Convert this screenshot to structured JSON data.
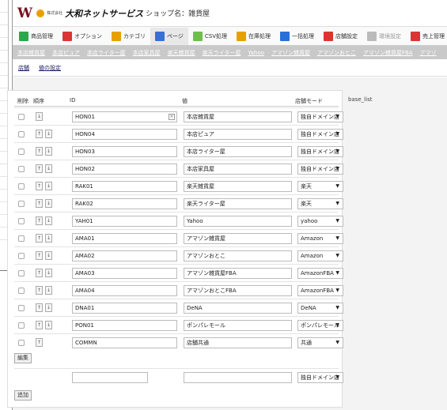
{
  "header": {
    "logo": "W",
    "company_small": "株式会社",
    "company_name": "大和ネットサービス",
    "shop_label": "ショップ名：雑貨屋"
  },
  "menu": [
    {
      "label": "商品管理",
      "icon": "product-icon",
      "color": "#2aa84a"
    },
    {
      "label": "オプション",
      "icon": "option-icon",
      "color": "#d33"
    },
    {
      "label": "カテゴリ",
      "icon": "category-icon",
      "color": "#e8a000"
    },
    {
      "label": "ページ",
      "icon": "page-icon",
      "color": "#3a6fd8"
    },
    {
      "label": "CSV処理",
      "icon": "csv-icon",
      "color": "#6cc04a"
    },
    {
      "label": "在庫処理",
      "icon": "stock-icon",
      "color": "#e8a000"
    },
    {
      "label": "一括処理",
      "icon": "batch-icon",
      "color": "#2a6fd8"
    },
    {
      "label": "店舗設定",
      "icon": "store-settings-icon",
      "color": "#d33"
    },
    {
      "label": "環境設定",
      "icon": "env-settings-icon",
      "color": "#bbb"
    },
    {
      "label": "売上管理",
      "icon": "sales-icon",
      "color": "#d33"
    }
  ],
  "subnav": [
    "本店雑貨屋",
    "本店ピュア",
    "本店ライター屋",
    "本店家具屋",
    "楽天雑貨屋",
    "楽天ライター屋",
    "Yahoo",
    "アマゾン雑貨屋",
    "アマゾンおとこ",
    "アマゾン雑貨屋FBA",
    "アマゾ"
  ],
  "tabs": [
    "店舗",
    "値の設定"
  ],
  "side_note": "base_list",
  "table": {
    "headers": {
      "del": "削除",
      "order": "順序",
      "id": "ID",
      "value": "値",
      "mode": "店舗モード"
    },
    "rows": [
      {
        "id": "HON01",
        "value": "本店雑貨屋",
        "mode": "独自ドメイン店"
      },
      {
        "id": "HON04",
        "value": "本店ピュア",
        "mode": "独自ドメイン店"
      },
      {
        "id": "HON03",
        "value": "本店ライター屋",
        "mode": "独自ドメイン店"
      },
      {
        "id": "HON02",
        "value": "本店家具屋",
        "mode": "独自ドメイン店"
      },
      {
        "id": "RAK01",
        "value": "楽天雑貨屋",
        "mode": "楽天"
      },
      {
        "id": "RAK02",
        "value": "楽天ライター屋",
        "mode": "楽天"
      },
      {
        "id": "YAH01",
        "value": "Yahoo",
        "mode": "yahoo"
      },
      {
        "id": "AMA01",
        "value": "アマゾン雑貨屋",
        "mode": "Amazon"
      },
      {
        "id": "AMA02",
        "value": "アマゾンおとこ",
        "mode": "Amazon"
      },
      {
        "id": "AMA03",
        "value": "アマゾン雑貨屋FBA",
        "mode": "AmazonFBA"
      },
      {
        "id": "AMA04",
        "value": "アマゾンおとこFBA",
        "mode": "AmazonFBA"
      },
      {
        "id": "DNA01",
        "value": "DeNA",
        "mode": "DeNA"
      },
      {
        "id": "PON01",
        "value": "ポンパレモール",
        "mode": "ポンパレモール"
      },
      {
        "id": "COMMN",
        "value": "店舗共通",
        "mode": "共通"
      }
    ],
    "edit_button": "編集",
    "new_row_mode": "独自ドメイン店",
    "add_button": "追加"
  }
}
